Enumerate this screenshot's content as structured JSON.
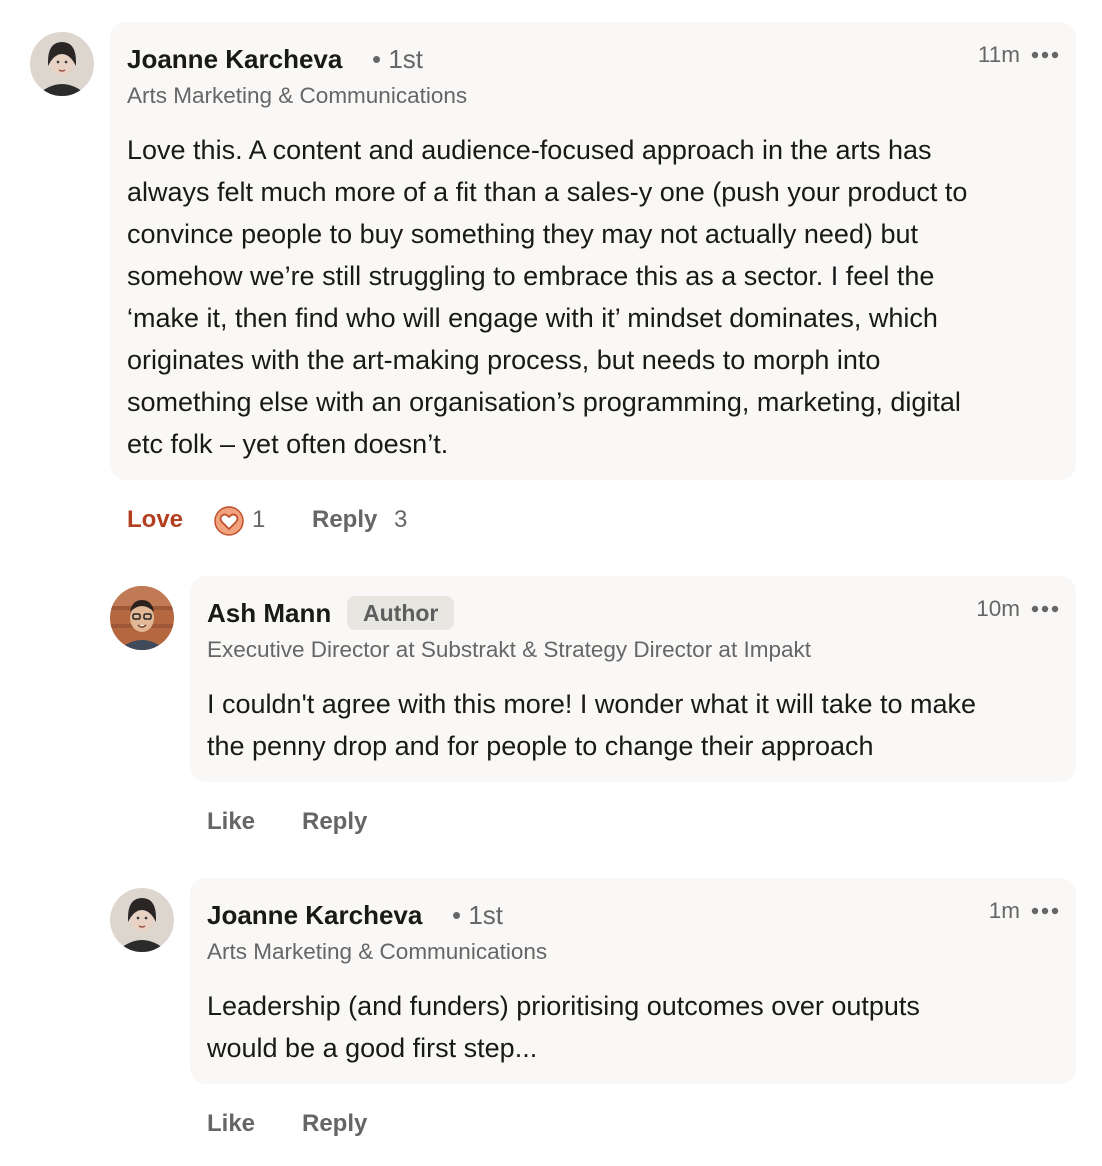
{
  "comments": [
    {
      "author": "Joanne Karcheva",
      "degree": "• 1st",
      "headline": "Arts Marketing & Communications",
      "time": "11m",
      "text_lines": [
        "Love this. A content and audience-focused approach in the arts has",
        "always felt much more of a fit than a sales-y one (push your product to",
        "convince people to buy something they may not actually need) but",
        "somehow we’re still struggling to embrace this as a sector. I feel the",
        "‘make it, then find who will engage with it’ mindset dominates, which",
        "originates with the art-making process, but needs to morph into",
        "something else with an organisation’s programming, marketing, digital",
        "etc folk – yet often doesn’t."
      ],
      "actions": {
        "reaction_label": "Love",
        "reaction_count": "1",
        "reply_label": "Reply",
        "reply_count": "3"
      },
      "icons": {
        "avatar": "avatar-joanne",
        "reaction": "love-heart-icon",
        "more": "more-options-icon"
      }
    },
    {
      "author": "Ash Mann",
      "badge": "Author",
      "headline": "Executive Director at Substrakt & Strategy Director at Impakt",
      "time": "10m",
      "text_lines": [
        "I couldn't agree with this more! I wonder what it will take to make",
        "the penny drop and for people to change their approach"
      ],
      "actions": {
        "like_label": "Like",
        "reply_label": "Reply"
      },
      "icons": {
        "avatar": "avatar-ash",
        "more": "more-options-icon"
      }
    },
    {
      "author": "Joanne Karcheva",
      "degree": "• 1st",
      "headline": "Arts Marketing & Communications",
      "time": "1m",
      "text_lines": [
        "Leadership (and funders) prioritising outcomes over outputs",
        "would be a good first step..."
      ],
      "actions": {
        "like_label": "Like",
        "reply_label": "Reply"
      },
      "icons": {
        "avatar": "avatar-joanne",
        "more": "more-options-icon"
      }
    }
  ],
  "colors": {
    "bubble_bg": "#f9f8f6",
    "love_active": "#b24020",
    "muted_text": "#666666",
    "badge_bg": "#e8e6e1"
  }
}
